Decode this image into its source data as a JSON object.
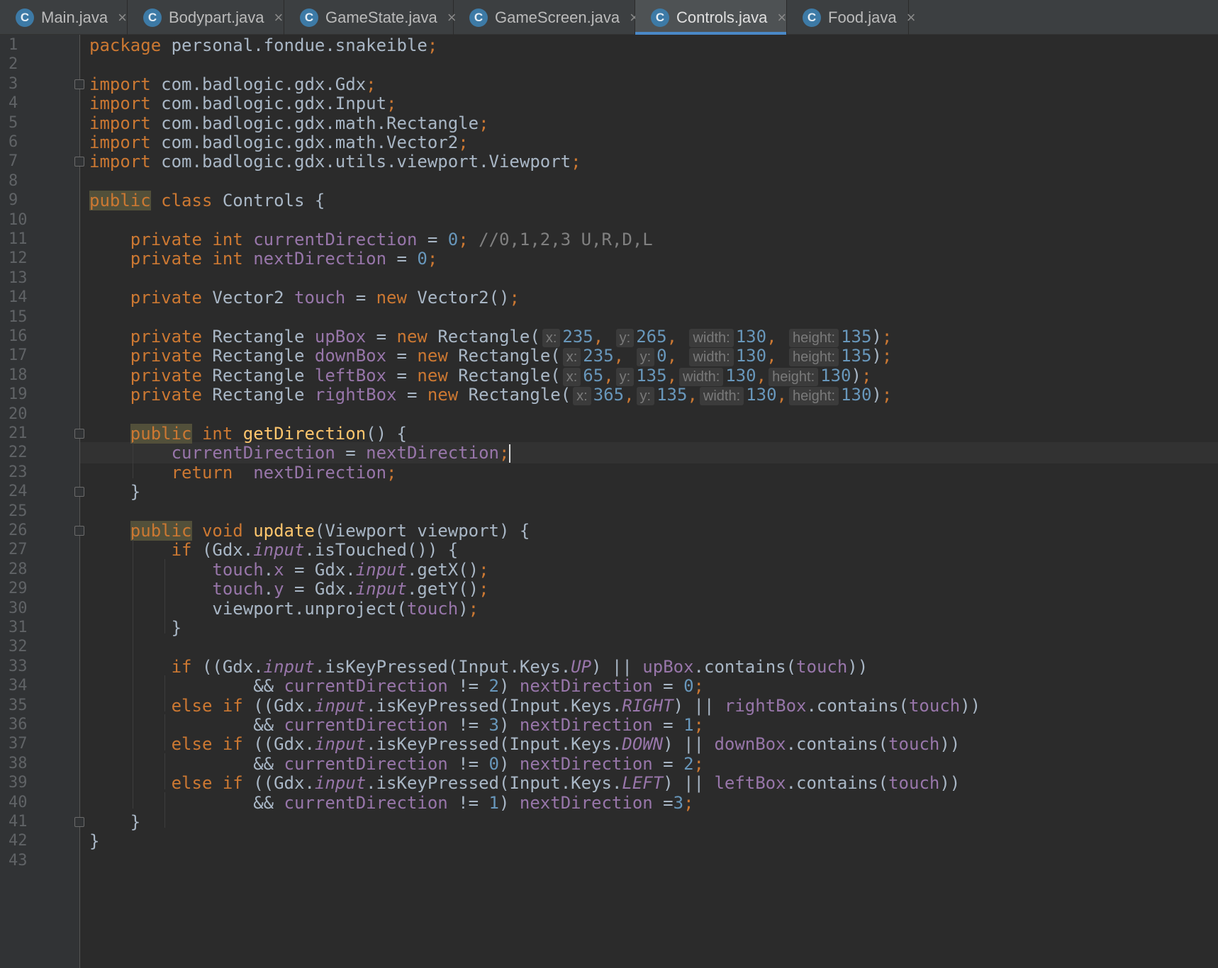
{
  "tabs": [
    {
      "label": "Main.java",
      "icon": "C",
      "active": false
    },
    {
      "label": "Bodypart.java",
      "icon": "C",
      "active": false
    },
    {
      "label": "GameState.java",
      "icon": "C",
      "active": false
    },
    {
      "label": "GameScreen.java",
      "icon": "C",
      "active": false
    },
    {
      "label": "Controls.java",
      "icon": "C",
      "active": true
    },
    {
      "label": "Food.java",
      "icon": "C",
      "active": false
    }
  ],
  "close_glyph": "×",
  "editor": {
    "line_numbers": [
      "1",
      "2",
      "3",
      "4",
      "5",
      "6",
      "7",
      "8",
      "9",
      "10",
      "11",
      "12",
      "13",
      "14",
      "15",
      "16",
      "17",
      "18",
      "19",
      "20",
      "21",
      "22",
      "23",
      "24",
      "25",
      "26",
      "27",
      "28",
      "29",
      "30",
      "31",
      "32",
      "33",
      "34",
      "35",
      "36",
      "37",
      "38",
      "39",
      "40",
      "41",
      "42",
      "43"
    ],
    "current_line": "22",
    "colors": {
      "keyword": "#cc7832",
      "field": "#9876aa",
      "number": "#6897bb",
      "comment": "#808080",
      "method": "#ffc66d",
      "text": "#a9b7c6"
    },
    "lines": [
      [
        {
          "t": "package",
          "c": "kw"
        },
        {
          "t": " personal.fondue.snakeible"
        },
        {
          "t": ";",
          "c": "kw"
        }
      ],
      [],
      [
        {
          "t": "import",
          "c": "kw"
        },
        {
          "t": " com.badlogic.gdx.Gdx"
        },
        {
          "t": ";",
          "c": "kw"
        }
      ],
      [
        {
          "t": "import",
          "c": "kw"
        },
        {
          "t": " com.badlogic.gdx.Input"
        },
        {
          "t": ";",
          "c": "kw"
        }
      ],
      [
        {
          "t": "import",
          "c": "kw"
        },
        {
          "t": " com.badlogic.gdx.math.Rectangle"
        },
        {
          "t": ";",
          "c": "kw"
        }
      ],
      [
        {
          "t": "import",
          "c": "kw"
        },
        {
          "t": " com.badlogic.gdx.math.Vector2"
        },
        {
          "t": ";",
          "c": "kw"
        }
      ],
      [
        {
          "t": "import",
          "c": "kw"
        },
        {
          "t": " com.badlogic.gdx.utils.viewport.Viewport"
        },
        {
          "t": ";",
          "c": "kw"
        }
      ],
      [],
      [
        {
          "t": "public",
          "c": "kw pub"
        },
        {
          "t": " "
        },
        {
          "t": "class",
          "c": "kw"
        },
        {
          "t": " Controls {"
        }
      ],
      [],
      [
        {
          "t": "    "
        },
        {
          "t": "private int",
          "c": "kw"
        },
        {
          "t": " "
        },
        {
          "t": "currentDirection",
          "c": "fld"
        },
        {
          "t": " = "
        },
        {
          "t": "0",
          "c": "num"
        },
        {
          "t": ";",
          "c": "kw"
        },
        {
          "t": " //0,1,2,3 U,R,D,L",
          "c": "cmt"
        }
      ],
      [
        {
          "t": "    "
        },
        {
          "t": "private int",
          "c": "kw"
        },
        {
          "t": " "
        },
        {
          "t": "nextDirection",
          "c": "fld"
        },
        {
          "t": " = "
        },
        {
          "t": "0",
          "c": "num"
        },
        {
          "t": ";",
          "c": "kw"
        }
      ],
      [],
      [
        {
          "t": "    "
        },
        {
          "t": "private",
          "c": "kw"
        },
        {
          "t": " Vector2 "
        },
        {
          "t": "touch",
          "c": "fld"
        },
        {
          "t": " = "
        },
        {
          "t": "new",
          "c": "kw"
        },
        {
          "t": " Vector2()"
        },
        {
          "t": ";",
          "c": "kw"
        }
      ],
      [],
      [
        {
          "t": "    "
        },
        {
          "t": "private",
          "c": "kw"
        },
        {
          "t": " Rectangle "
        },
        {
          "t": "upBox",
          "c": "fld"
        },
        {
          "t": " = "
        },
        {
          "t": "new",
          "c": "kw"
        },
        {
          "t": " Rectangle("
        },
        {
          "t": "x:",
          "c": "hint"
        },
        {
          "t": "235",
          "c": "num"
        },
        {
          "t": ",",
          "c": "kw"
        },
        {
          "t": " "
        },
        {
          "t": "y:",
          "c": "hint"
        },
        {
          "t": "265",
          "c": "num"
        },
        {
          "t": ",",
          "c": "kw"
        },
        {
          "t": " "
        },
        {
          "t": "width:",
          "c": "hint"
        },
        {
          "t": "130",
          "c": "num"
        },
        {
          "t": ",",
          "c": "kw"
        },
        {
          "t": " "
        },
        {
          "t": "height:",
          "c": "hint"
        },
        {
          "t": "135",
          "c": "num"
        },
        {
          "t": ")"
        },
        {
          "t": ";",
          "c": "kw"
        }
      ],
      [
        {
          "t": "    "
        },
        {
          "t": "private",
          "c": "kw"
        },
        {
          "t": " Rectangle "
        },
        {
          "t": "downBox",
          "c": "fld"
        },
        {
          "t": " = "
        },
        {
          "t": "new",
          "c": "kw"
        },
        {
          "t": " Rectangle("
        },
        {
          "t": "x:",
          "c": "hint"
        },
        {
          "t": "235",
          "c": "num"
        },
        {
          "t": ",",
          "c": "kw"
        },
        {
          "t": " "
        },
        {
          "t": "y:",
          "c": "hint"
        },
        {
          "t": "0",
          "c": "num"
        },
        {
          "t": ",",
          "c": "kw"
        },
        {
          "t": " "
        },
        {
          "t": "width:",
          "c": "hint"
        },
        {
          "t": "130",
          "c": "num"
        },
        {
          "t": ",",
          "c": "kw"
        },
        {
          "t": " "
        },
        {
          "t": "height:",
          "c": "hint"
        },
        {
          "t": "135",
          "c": "num"
        },
        {
          "t": ")"
        },
        {
          "t": ";",
          "c": "kw"
        }
      ],
      [
        {
          "t": "    "
        },
        {
          "t": "private",
          "c": "kw"
        },
        {
          "t": " Rectangle "
        },
        {
          "t": "leftBox",
          "c": "fld"
        },
        {
          "t": " = "
        },
        {
          "t": "new",
          "c": "kw"
        },
        {
          "t": " Rectangle("
        },
        {
          "t": "x:",
          "c": "hint"
        },
        {
          "t": "65",
          "c": "num"
        },
        {
          "t": ",",
          "c": "kw"
        },
        {
          "t": "y:",
          "c": "hint"
        },
        {
          "t": "135",
          "c": "num"
        },
        {
          "t": ",",
          "c": "kw"
        },
        {
          "t": "width:",
          "c": "hint"
        },
        {
          "t": "130",
          "c": "num"
        },
        {
          "t": ",",
          "c": "kw"
        },
        {
          "t": "height:",
          "c": "hint"
        },
        {
          "t": "130",
          "c": "num"
        },
        {
          "t": ")"
        },
        {
          "t": ";",
          "c": "kw"
        }
      ],
      [
        {
          "t": "    "
        },
        {
          "t": "private",
          "c": "kw"
        },
        {
          "t": " Rectangle "
        },
        {
          "t": "rightBox",
          "c": "fld"
        },
        {
          "t": " = "
        },
        {
          "t": "new",
          "c": "kw"
        },
        {
          "t": " Rectangle("
        },
        {
          "t": "x:",
          "c": "hint"
        },
        {
          "t": "365",
          "c": "num"
        },
        {
          "t": ",",
          "c": "kw"
        },
        {
          "t": "y:",
          "c": "hint"
        },
        {
          "t": "135",
          "c": "num"
        },
        {
          "t": ",",
          "c": "kw"
        },
        {
          "t": "width:",
          "c": "hint"
        },
        {
          "t": "130",
          "c": "num"
        },
        {
          "t": ",",
          "c": "kw"
        },
        {
          "t": "height:",
          "c": "hint"
        },
        {
          "t": "130",
          "c": "num"
        },
        {
          "t": ")"
        },
        {
          "t": ";",
          "c": "kw"
        }
      ],
      [],
      [
        {
          "t": "    "
        },
        {
          "t": "public",
          "c": "kw pub"
        },
        {
          "t": " "
        },
        {
          "t": "int",
          "c": "kw"
        },
        {
          "t": " "
        },
        {
          "t": "getDirection",
          "c": "fn"
        },
        {
          "t": "() {"
        }
      ],
      [
        {
          "t": "        "
        },
        {
          "t": "currentDirection",
          "c": "fld"
        },
        {
          "t": " = "
        },
        {
          "t": "nextDirection",
          "c": "fld"
        },
        {
          "t": ";",
          "c": "kw"
        },
        {
          "t": "",
          "c": "cursor"
        }
      ],
      [
        {
          "t": "        "
        },
        {
          "t": "return",
          "c": "kw"
        },
        {
          "t": "  "
        },
        {
          "t": "nextDirection",
          "c": "fld"
        },
        {
          "t": ";",
          "c": "kw"
        }
      ],
      [
        {
          "t": "    }"
        }
      ],
      [],
      [
        {
          "t": "    "
        },
        {
          "t": "public",
          "c": "kw pub"
        },
        {
          "t": " "
        },
        {
          "t": "void",
          "c": "kw"
        },
        {
          "t": " "
        },
        {
          "t": "update",
          "c": "fn"
        },
        {
          "t": "(Viewport viewport) {"
        }
      ],
      [
        {
          "t": "        "
        },
        {
          "t": "if",
          "c": "kw"
        },
        {
          "t": " (Gdx."
        },
        {
          "t": "input",
          "c": "fld it"
        },
        {
          "t": ".isTouched()) {"
        }
      ],
      [
        {
          "t": "            "
        },
        {
          "t": "touch",
          "c": "fld"
        },
        {
          "t": "."
        },
        {
          "t": "x",
          "c": "fld"
        },
        {
          "t": " = Gdx."
        },
        {
          "t": "input",
          "c": "fld it"
        },
        {
          "t": ".getX()"
        },
        {
          "t": ";",
          "c": "kw"
        }
      ],
      [
        {
          "t": "            "
        },
        {
          "t": "touch",
          "c": "fld"
        },
        {
          "t": "."
        },
        {
          "t": "y",
          "c": "fld"
        },
        {
          "t": " = Gdx."
        },
        {
          "t": "input",
          "c": "fld it"
        },
        {
          "t": ".getY()"
        },
        {
          "t": ";",
          "c": "kw"
        }
      ],
      [
        {
          "t": "            viewport.unproject("
        },
        {
          "t": "touch",
          "c": "fld"
        },
        {
          "t": ")"
        },
        {
          "t": ";",
          "c": "kw"
        }
      ],
      [
        {
          "t": "        }"
        }
      ],
      [],
      [
        {
          "t": "        "
        },
        {
          "t": "if",
          "c": "kw"
        },
        {
          "t": " ((Gdx."
        },
        {
          "t": "input",
          "c": "fld it"
        },
        {
          "t": ".isKeyPressed(Input.Keys."
        },
        {
          "t": "UP",
          "c": "fld it"
        },
        {
          "t": ") || "
        },
        {
          "t": "upBox",
          "c": "fld"
        },
        {
          "t": ".contains("
        },
        {
          "t": "touch",
          "c": "fld"
        },
        {
          "t": "))"
        }
      ],
      [
        {
          "t": "                && "
        },
        {
          "t": "currentDirection",
          "c": "fld"
        },
        {
          "t": " != "
        },
        {
          "t": "2",
          "c": "num"
        },
        {
          "t": ") "
        },
        {
          "t": "nextDirection",
          "c": "fld"
        },
        {
          "t": " = "
        },
        {
          "t": "0",
          "c": "num"
        },
        {
          "t": ";",
          "c": "kw"
        }
      ],
      [
        {
          "t": "        "
        },
        {
          "t": "else if",
          "c": "kw"
        },
        {
          "t": " ((Gdx."
        },
        {
          "t": "input",
          "c": "fld it"
        },
        {
          "t": ".isKeyPressed(Input.Keys."
        },
        {
          "t": "RIGHT",
          "c": "fld it"
        },
        {
          "t": ") || "
        },
        {
          "t": "rightBox",
          "c": "fld"
        },
        {
          "t": ".contains("
        },
        {
          "t": "touch",
          "c": "fld"
        },
        {
          "t": "))"
        }
      ],
      [
        {
          "t": "                && "
        },
        {
          "t": "currentDirection",
          "c": "fld"
        },
        {
          "t": " != "
        },
        {
          "t": "3",
          "c": "num"
        },
        {
          "t": ") "
        },
        {
          "t": "nextDirection",
          "c": "fld"
        },
        {
          "t": " = "
        },
        {
          "t": "1",
          "c": "num"
        },
        {
          "t": ";",
          "c": "kw"
        }
      ],
      [
        {
          "t": "        "
        },
        {
          "t": "else if",
          "c": "kw"
        },
        {
          "t": " ((Gdx."
        },
        {
          "t": "input",
          "c": "fld it"
        },
        {
          "t": ".isKeyPressed(Input.Keys."
        },
        {
          "t": "DOWN",
          "c": "fld it"
        },
        {
          "t": ") || "
        },
        {
          "t": "downBox",
          "c": "fld"
        },
        {
          "t": ".contains("
        },
        {
          "t": "touch",
          "c": "fld"
        },
        {
          "t": "))"
        }
      ],
      [
        {
          "t": "                && "
        },
        {
          "t": "currentDirection",
          "c": "fld"
        },
        {
          "t": " != "
        },
        {
          "t": "0",
          "c": "num"
        },
        {
          "t": ") "
        },
        {
          "t": "nextDirection",
          "c": "fld"
        },
        {
          "t": " = "
        },
        {
          "t": "2",
          "c": "num"
        },
        {
          "t": ";",
          "c": "kw"
        }
      ],
      [
        {
          "t": "        "
        },
        {
          "t": "else if",
          "c": "kw"
        },
        {
          "t": " ((Gdx."
        },
        {
          "t": "input",
          "c": "fld it"
        },
        {
          "t": ".isKeyPressed(Input.Keys."
        },
        {
          "t": "LEFT",
          "c": "fld it"
        },
        {
          "t": ") || "
        },
        {
          "t": "leftBox",
          "c": "fld"
        },
        {
          "t": ".contains("
        },
        {
          "t": "touch",
          "c": "fld"
        },
        {
          "t": "))"
        }
      ],
      [
        {
          "t": "                && "
        },
        {
          "t": "currentDirection",
          "c": "fld"
        },
        {
          "t": " != "
        },
        {
          "t": "1",
          "c": "num"
        },
        {
          "t": ") "
        },
        {
          "t": "nextDirection",
          "c": "fld"
        },
        {
          "t": " ="
        },
        {
          "t": "3",
          "c": "num"
        },
        {
          "t": ";",
          "c": "kw"
        }
      ],
      [
        {
          "t": "    }"
        }
      ],
      [
        {
          "t": "}"
        }
      ],
      []
    ]
  }
}
